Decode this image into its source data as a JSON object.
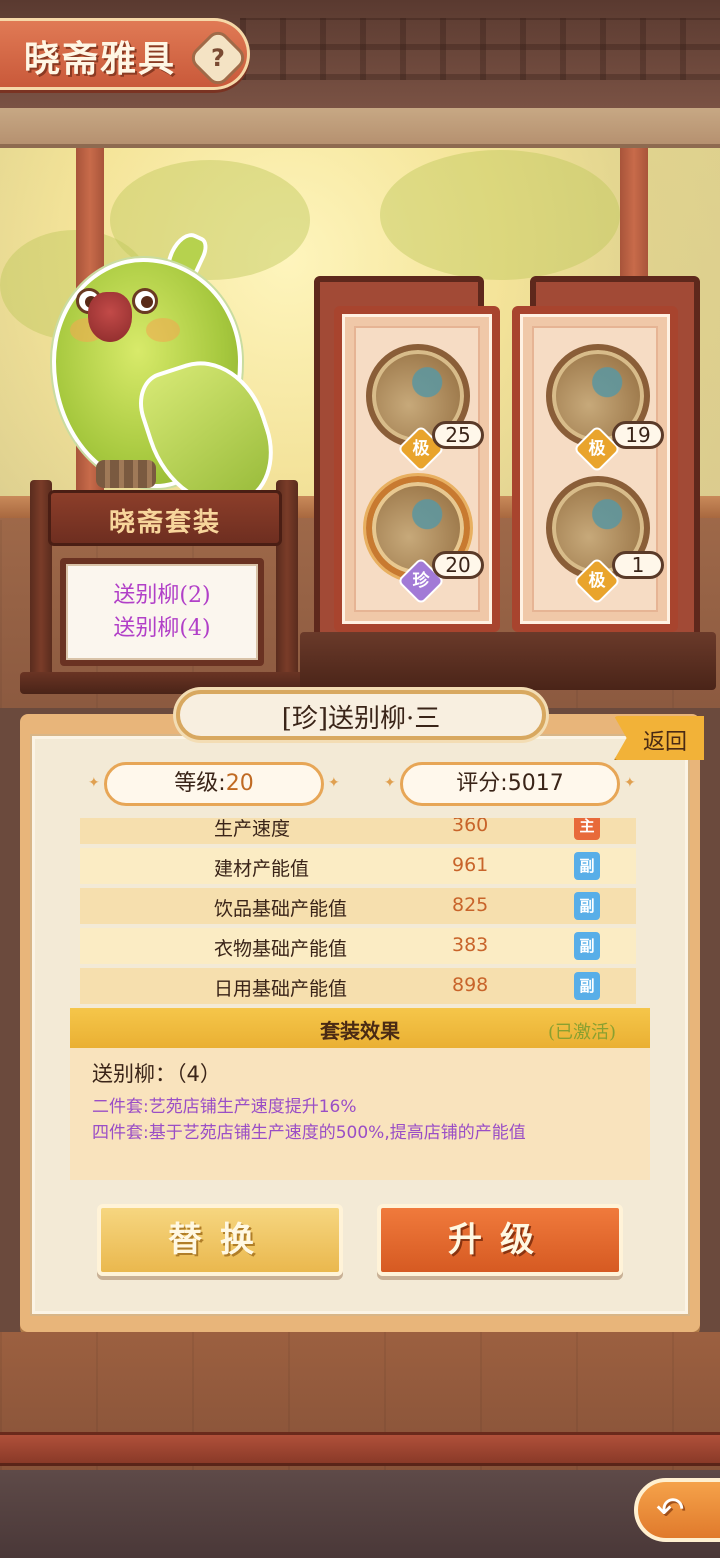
{
  "header": {
    "title": "晓斋雅具",
    "help_icon": "?"
  },
  "suit_sign": {
    "title": "晓斋套装",
    "lines": [
      "送别柳(2)",
      "送别柳(4)"
    ]
  },
  "items": [
    {
      "grade": "极",
      "level": "25",
      "grade_type": "ji"
    },
    {
      "grade": "极",
      "level": "19",
      "grade_type": "ji"
    },
    {
      "grade": "珍",
      "level": "20",
      "grade_type": "zhen"
    },
    {
      "grade": "极",
      "level": "1",
      "grade_type": "ji"
    }
  ],
  "detail": {
    "name": "[珍]送别柳·三",
    "back_label": "返回",
    "level_label": "等级:",
    "level_value": "20",
    "score_label": "评分:",
    "score_value": "5017",
    "attributes": [
      {
        "name": "生产速度",
        "value": "360",
        "tag": "主",
        "tag_type": "zhu"
      },
      {
        "name": "建材产能值",
        "value": "961",
        "tag": "副",
        "tag_type": "fu"
      },
      {
        "name": "饮品基础产能值",
        "value": "825",
        "tag": "副",
        "tag_type": "fu"
      },
      {
        "name": "衣物基础产能值",
        "value": "383",
        "tag": "副",
        "tag_type": "fu"
      },
      {
        "name": "日用基础产能值",
        "value": "898",
        "tag": "副",
        "tag_type": "fu"
      }
    ],
    "set_effect": {
      "title": "套装效果",
      "status": "(已激活)",
      "set_name": "送别柳：（4）",
      "two_piece": "二件套:艺苑店铺生产速度提升16%",
      "four_piece": "四件套:基于艺苑店铺生产速度的500%,提高店铺的产能值"
    },
    "buttons": {
      "replace": "替换",
      "upgrade": "升级"
    }
  },
  "footer": {
    "return_icon": "↶"
  },
  "colors": {
    "accent_orange": "#d65a22",
    "gold": "#eab84e",
    "purple_text": "#9a4ec6",
    "value_orange": "#c8642a"
  }
}
